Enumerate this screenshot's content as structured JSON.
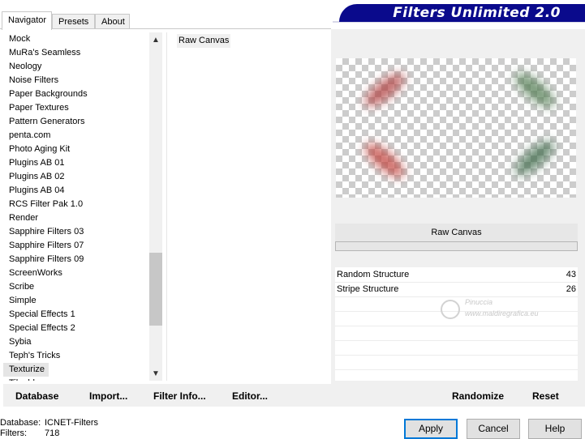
{
  "tabs": [
    {
      "label": "Navigator",
      "active": true
    },
    {
      "label": "Presets",
      "active": false
    },
    {
      "label": "About",
      "active": false
    }
  ],
  "banner": {
    "title": "Filters Unlimited 2.0",
    "color": "#0a0a8c"
  },
  "navigator": {
    "items": [
      "Mock",
      "MuRa's Seamless",
      "Neology",
      "Noise Filters",
      "Paper Backgrounds",
      "Paper Textures",
      "Pattern Generators",
      "penta.com",
      "Photo Aging Kit",
      "Plugins AB 01",
      "Plugins AB 02",
      "Plugins AB 04",
      "RCS Filter Pak 1.0",
      "Render",
      "Sapphire Filters 03",
      "Sapphire Filters 07",
      "Sapphire Filters 09",
      "ScreenWorks",
      "Scribe",
      "Simple",
      "Special Effects 1",
      "Special Effects 2",
      "Sybia",
      "Teph's Tricks",
      "Texturize",
      "Tileables"
    ],
    "selected": "Texturize"
  },
  "filters": {
    "items": [
      "Raw Canvas"
    ],
    "selected": "Raw Canvas"
  },
  "preview": {
    "filter_name": "Raw Canvas"
  },
  "params": [
    {
      "label": "Random Structure",
      "value": "43"
    },
    {
      "label": "Stripe Structure",
      "value": "26"
    }
  ],
  "watermark": {
    "line1": "Pinuccia",
    "line2": "www.maldiregrafica.eu"
  },
  "left_actions": {
    "database": "Database",
    "import": "Import...",
    "filter_info": "Filter Info...",
    "editor": "Editor..."
  },
  "right_actions": {
    "randomize": "Randomize",
    "reset": "Reset"
  },
  "status": {
    "database_label": "Database:",
    "database_value": "ICNET-Filters",
    "filters_label": "Filters:",
    "filters_value": "718"
  },
  "buttons": {
    "apply": "Apply",
    "cancel": "Cancel",
    "help": "Help"
  },
  "icons": {
    "scroll_up": "chevron-up-icon",
    "scroll_down": "chevron-down-icon"
  }
}
